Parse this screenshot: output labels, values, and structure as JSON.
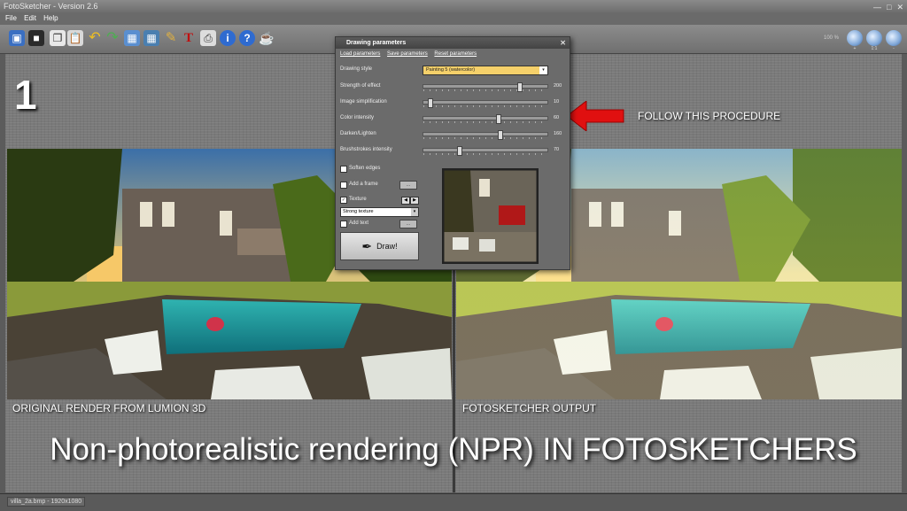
{
  "window": {
    "title": "FotoSketcher - Version 2.6"
  },
  "menu": [
    "File",
    "Edit",
    "Help"
  ],
  "toolbar": {
    "icons": [
      "open-image-icon",
      "save-icon",
      "copy-icon",
      "paste-icon",
      "undo-icon",
      "redo-icon",
      "before-image-icon",
      "after-image-icon",
      "paint-icon",
      "text-icon",
      "print-icon",
      "info-icon",
      "help-icon",
      "coffee-icon"
    ],
    "zoom_readout": "100 %",
    "zoom_labels": [
      "+",
      "1:1",
      "-"
    ]
  },
  "step_number": "1",
  "callout": {
    "text": "FOLLOW THIS PROCEDURE",
    "arrow_color": "#e01010"
  },
  "dialog": {
    "title": "Drawing parameters",
    "links": {
      "load": "Load parameters",
      "save": "Save parameters",
      "reset": "Reset parameters"
    },
    "drawing_style_label": "Drawing style",
    "drawing_style_value": "Painting 5 (watercolor)",
    "sliders": [
      {
        "label": "Strength of effect",
        "value": "200",
        "fraction": 0.78
      },
      {
        "label": "Image simplification",
        "value": "10",
        "fraction": 0.04
      },
      {
        "label": "Color intensity",
        "value": "60",
        "fraction": 0.6
      },
      {
        "label": "Darken/Lighten",
        "value": "160",
        "fraction": 0.62
      },
      {
        "label": "Brushstrokes intensity",
        "value": "70",
        "fraction": 0.28
      }
    ],
    "options": {
      "soften_edges": "Soften edges",
      "add_frame": "Add a frame",
      "texture": "Texture",
      "texture_value": "Strong texture",
      "add_text": "Add text",
      "more_btn": "...",
      "draw_button": "Draw!"
    },
    "checked": {
      "soften_edges": false,
      "add_frame": false,
      "texture": true,
      "add_text": false
    }
  },
  "captions": {
    "left": "ORIGINAL RENDER FROM LUMION 3D",
    "right": "FOTOSKETCHER OUTPUT"
  },
  "headline": "Non-photorealistic rendering (NPR) IN FOTOSKETCHERS",
  "status": "villa_2a.bmp - 1920x1080"
}
